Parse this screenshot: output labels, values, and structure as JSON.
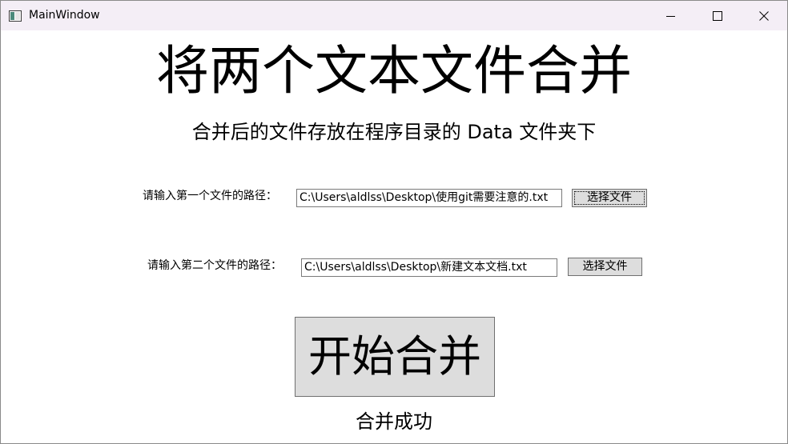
{
  "window": {
    "title": "MainWindow",
    "controls": {
      "minimize_icon": "minimize-icon",
      "maximize_icon": "maximize-icon",
      "close_icon": "close-icon"
    },
    "app_icon": "window-app-icon"
  },
  "main": {
    "heading": "将两个文本文件合并",
    "subheading": "合并后的文件存放在程序目录的 Data 文件夹下",
    "file1": {
      "label": "请输入第一个文件的路径：",
      "value": "C:\\Users\\aldlss\\Desktop\\使用git需要注意的.txt",
      "button_label": "选择文件"
    },
    "file2": {
      "label": "请输入第二个文件的路径：",
      "value": "C:\\Users\\aldlss\\Desktop\\新建文本文档.txt",
      "button_label": "选择文件"
    },
    "merge_button_label": "开始合并",
    "status_text": "合并成功"
  },
  "colors": {
    "titlebar_bg": "#f4eef6",
    "button_bg": "#dddddd",
    "button_border": "#707070",
    "text": "#000000"
  }
}
